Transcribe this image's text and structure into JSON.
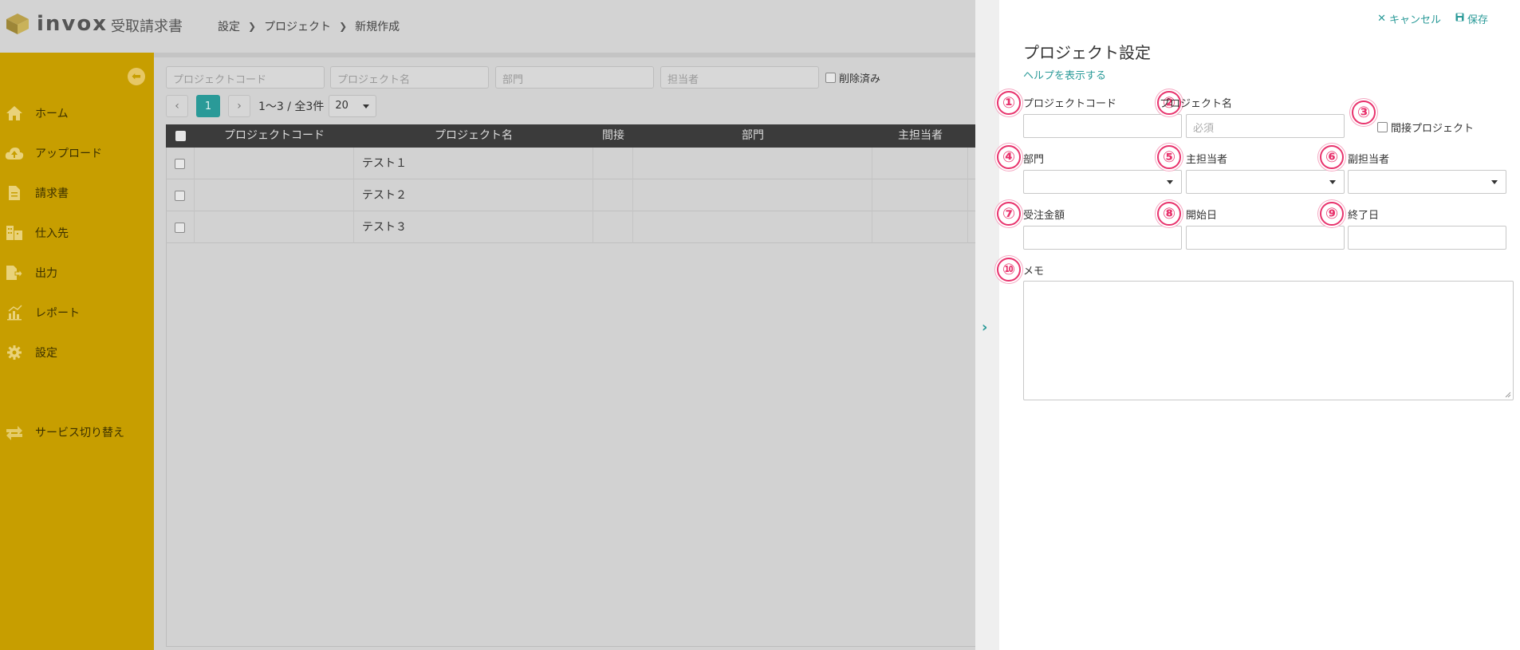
{
  "header": {
    "logo_text": "invox",
    "logo_sub": "受取請求書",
    "breadcrumb": [
      "設定",
      "プロジェクト",
      "新規作成"
    ]
  },
  "sidebar": {
    "items": [
      {
        "label": "ホーム",
        "icon": "home-icon"
      },
      {
        "label": "アップロード",
        "icon": "cloud-upload-icon"
      },
      {
        "label": "請求書",
        "icon": "document-icon"
      },
      {
        "label": "仕入先",
        "icon": "building-icon"
      },
      {
        "label": "出力",
        "icon": "export-icon"
      },
      {
        "label": "レポート",
        "icon": "bar-chart-icon"
      },
      {
        "label": "設定",
        "icon": "gear-icon"
      },
      {
        "label": "サービス切り替え",
        "icon": "switch-icon"
      }
    ]
  },
  "filters": {
    "project_code_placeholder": "プロジェクトコード",
    "project_name_placeholder": "プロジェクト名",
    "department_placeholder": "部門",
    "owner_placeholder": "担当者",
    "deleted_label": "削除済み"
  },
  "pager": {
    "current_page": "1",
    "info": "1〜3 / 全3件",
    "per_page": "20"
  },
  "table": {
    "columns": [
      "プロジェクトコード",
      "プロジェクト名",
      "間接",
      "部門",
      "主担当者"
    ],
    "rows": [
      {
        "code": "",
        "name": "テスト１"
      },
      {
        "code": "",
        "name": "テスト２"
      },
      {
        "code": "",
        "name": "テスト３"
      }
    ]
  },
  "panel": {
    "cancel_label": "キャンセル",
    "save_label": "保存",
    "title": "プロジェクト設定",
    "help_link": "ヘルプを表示する",
    "fields": {
      "project_code": "プロジェクトコード",
      "project_name": "プロジェクト名",
      "project_name_placeholder": "必須",
      "indirect_project": "間接プロジェクト",
      "department": "部門",
      "main_owner": "主担当者",
      "sub_owner": "副担当者",
      "order_amount": "受注金額",
      "start_date": "開始日",
      "end_date": "終了日",
      "memo": "メモ"
    },
    "badges": [
      "①",
      "②",
      "③",
      "④",
      "⑤",
      "⑥",
      "⑦",
      "⑧",
      "⑨",
      "⑩"
    ]
  },
  "colors": {
    "sidebar": "#c79e00",
    "accent": "#2a9a98",
    "badge": "#e8336d"
  }
}
